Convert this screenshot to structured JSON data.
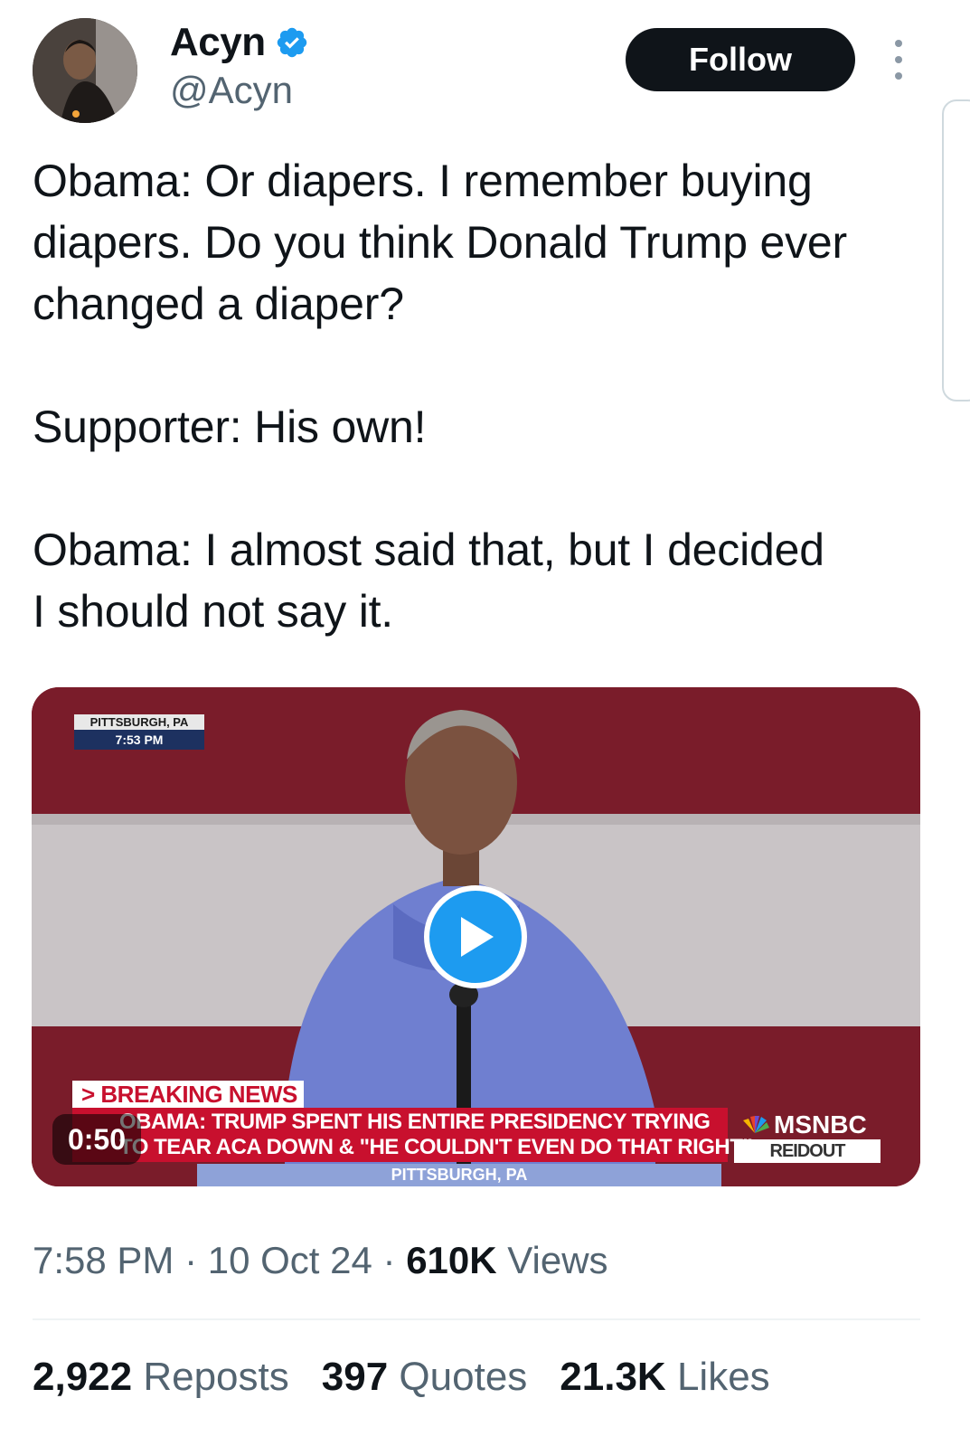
{
  "user": {
    "display_name": "Acyn",
    "handle": "@Acyn",
    "verified": true
  },
  "actions": {
    "follow_label": "Follow"
  },
  "tweet": {
    "lines": [
      "Obama: Or diapers. I remember buying",
      "diapers. Do you think Donald Trump ever",
      "changed a diaper?",
      "Supporter: His own!",
      "Obama: I almost said that, but I decided",
      "I should not say it."
    ]
  },
  "video": {
    "duration": "0:50",
    "location_stamp": "PITTSBURGH, PA",
    "time_stamp": "7:53 PM",
    "breaking_label": "> BREAKING NEWS",
    "headline_line1": "OBAMA: TRUMP SPENT HIS ENTIRE PRESIDENCY TRYING",
    "headline_line2": "TO TEAR ACA DOWN & \"HE COULDN'T EVEN DO THAT RIGHT\"",
    "location_bar": "PITTSBURGH, PA",
    "network": "MSNBC",
    "show": "REIDOUT"
  },
  "meta": {
    "time": "7:58 PM",
    "date": "10 Oct 24",
    "views_count": "610K",
    "views_label": "Views"
  },
  "stats": {
    "reposts_count": "2,922",
    "reposts_label": "Reposts",
    "quotes_count": "397",
    "quotes_label": "Quotes",
    "likes_count": "21.3K",
    "likes_label": "Likes"
  },
  "colors": {
    "accent": "#1d9bf0",
    "text": "#0f1419",
    "muted": "#536471",
    "breaking_red": "#c8102e"
  }
}
